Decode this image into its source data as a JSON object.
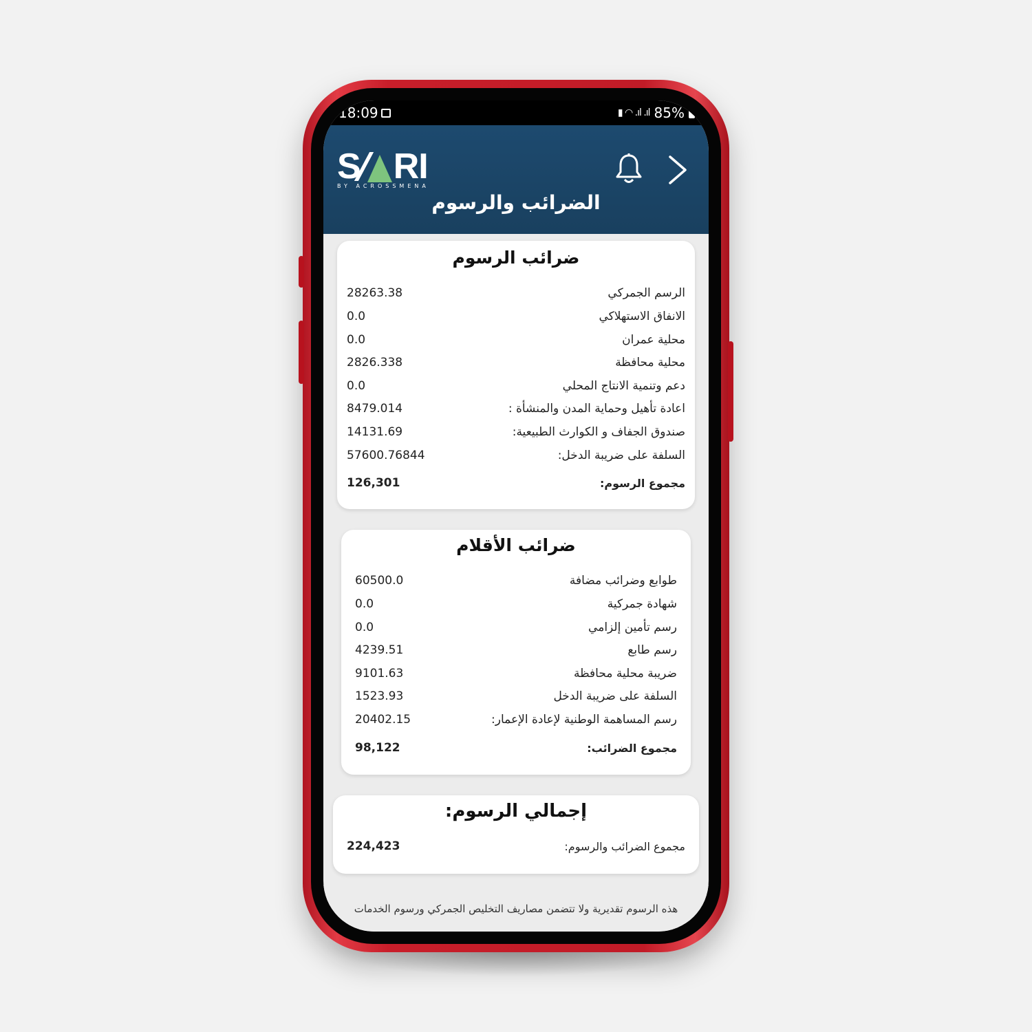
{
  "status_bar": {
    "time": "18:09",
    "battery": "85%"
  },
  "header": {
    "logo_text_left": "S",
    "logo_text_right": "RI",
    "logo_subtext": "BY ACROSSMENA",
    "title": "الضرائب والرسوم"
  },
  "fees_card": {
    "title": "ضرائب الرسوم",
    "rows": [
      {
        "label": "الرسم الجمركي",
        "value": "28263.38"
      },
      {
        "label": "الانفاق الاستهلاكي",
        "value": "0.0"
      },
      {
        "label": "محلية عمران",
        "value": "0.0"
      },
      {
        "label": "محلية محافظة",
        "value": "2826.338"
      },
      {
        "label": "دعم وتنمية الانتاج المحلي",
        "value": "0.0"
      },
      {
        "label": "اعادة تأهيل وحماية المدن والمنشأة :",
        "value": "8479.014"
      },
      {
        "label": "صندوق الجفاف و الكوارث الطبيعية:",
        "value": "14131.69"
      },
      {
        "label": "السلفة على ضريبة الدخل:",
        "value": "57600.76844"
      }
    ],
    "total_label": "مجموع الرسوم:",
    "total_value": "126,301"
  },
  "items_card": {
    "title": "ضرائب الأقلام",
    "rows": [
      {
        "label": "طوابع وضرائب مضافة",
        "value": "60500.0"
      },
      {
        "label": "شهادة جمركية",
        "value": "0.0"
      },
      {
        "label": "رسم تأمين إلزامي",
        "value": "0.0"
      },
      {
        "label": "رسم طابع",
        "value": "4239.51"
      },
      {
        "label": "ضريبة محلية محافظة",
        "value": "9101.63"
      },
      {
        "label": "السلفة على ضريبة الدخل",
        "value": "1523.93"
      },
      {
        "label": "رسم المساهمة الوطنية لإعادة الإعمار:",
        "value": "20402.15"
      }
    ],
    "total_label": "مجموع الضرائب:",
    "total_value": "98,122"
  },
  "grand_card": {
    "title": "إجمالي الرسوم:",
    "label": "مجموع الضرائب والرسوم:",
    "value": "224,423"
  },
  "disclaimer": "هذه الرسوم تقديرية ولا تتضمن مصاريف التخليص الجمركي ورسوم الخدمات",
  "colors": {
    "header": "#1d4a6f",
    "phone": "#c81e2a",
    "logo_accent": "#7ec47e"
  }
}
